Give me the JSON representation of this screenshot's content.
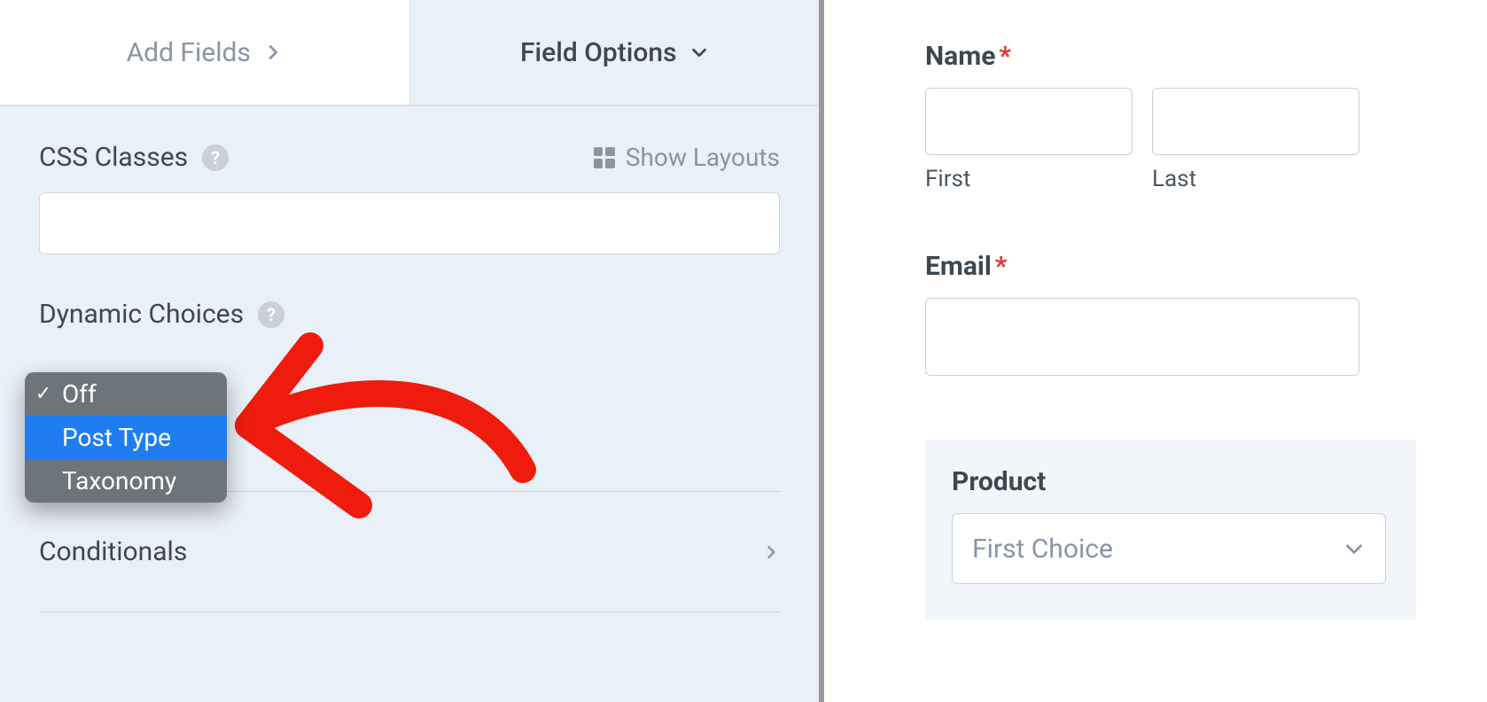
{
  "tabs": {
    "add_fields": "Add Fields",
    "field_options": "Field Options"
  },
  "css_classes": {
    "label": "CSS Classes",
    "show_layouts": "Show Layouts",
    "value": ""
  },
  "dynamic_choices": {
    "label": "Dynamic Choices",
    "options": [
      "Off",
      "Post Type",
      "Taxonomy"
    ],
    "selected": "Off",
    "highlighted": "Post Type"
  },
  "conditionals": {
    "label": "Conditionals"
  },
  "preview": {
    "name": {
      "label": "Name",
      "first_sub": "First",
      "last_sub": "Last"
    },
    "email": {
      "label": "Email"
    },
    "product": {
      "label": "Product",
      "placeholder": "First Choice"
    }
  }
}
